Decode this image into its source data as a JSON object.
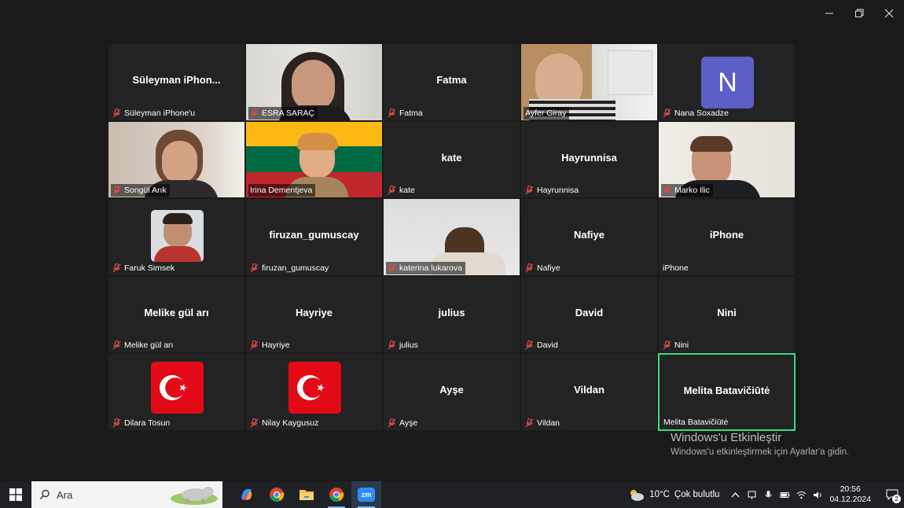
{
  "window": {
    "controls": [
      "minimize-icon",
      "restore-icon",
      "close-icon"
    ]
  },
  "tiles": [
    {
      "center": "Süleyman  iPhon...",
      "caption": "Süleyman iPhone'u",
      "muted": true,
      "kind": "name"
    },
    {
      "center": "",
      "caption": "ESRA SARAÇ",
      "muted": true,
      "kind": "video"
    },
    {
      "center": "Fatma",
      "caption": "Fatma",
      "muted": true,
      "kind": "name"
    },
    {
      "center": "",
      "caption": "Ayfer Giray",
      "muted": false,
      "kind": "video"
    },
    {
      "center": "",
      "caption": "Nana Soxadze",
      "muted": true,
      "kind": "avatar",
      "initial": "N"
    },
    {
      "center": "",
      "caption": "Songül Arık",
      "muted": true,
      "kind": "video"
    },
    {
      "center": "",
      "caption": "Irina Dementjeva",
      "muted": false,
      "kind": "video"
    },
    {
      "center": "kate",
      "caption": "kate",
      "muted": true,
      "kind": "name"
    },
    {
      "center": "Hayrunnisa",
      "caption": "Hayrunnisa",
      "muted": true,
      "kind": "name"
    },
    {
      "center": "",
      "caption": "Marko Ilic",
      "muted": true,
      "kind": "video"
    },
    {
      "center": "",
      "caption": "Faruk Simsek",
      "muted": true,
      "kind": "photo"
    },
    {
      "center": "firuzan_gumuscay",
      "caption": "firuzan_gumuscay",
      "muted": true,
      "kind": "name"
    },
    {
      "center": "",
      "caption": "katerina lukarova",
      "muted": true,
      "kind": "video"
    },
    {
      "center": "Nafiye",
      "caption": "Nafiye",
      "muted": true,
      "kind": "name"
    },
    {
      "center": "iPhone",
      "caption": "iPhone",
      "muted": false,
      "kind": "name"
    },
    {
      "center": "Melike gül arı",
      "caption": "Melike gül arı",
      "muted": true,
      "kind": "name"
    },
    {
      "center": "Hayriye",
      "caption": "Hayriye",
      "muted": true,
      "kind": "name"
    },
    {
      "center": "julius",
      "caption": "julius",
      "muted": true,
      "kind": "name"
    },
    {
      "center": "David",
      "caption": "David",
      "muted": true,
      "kind": "name"
    },
    {
      "center": "Nini",
      "caption": "Nini",
      "muted": true,
      "kind": "name"
    },
    {
      "center": "",
      "caption": "Dilara Tosun",
      "muted": true,
      "kind": "flag"
    },
    {
      "center": "",
      "caption": "Nilay Kaygusuz",
      "muted": true,
      "kind": "flag"
    },
    {
      "center": "Ayşe",
      "caption": "Ayşe",
      "muted": true,
      "kind": "name"
    },
    {
      "center": "Vildan",
      "caption": "Vildan",
      "muted": true,
      "kind": "name"
    },
    {
      "center": "Melita Batavičiūtė",
      "caption": "Melita Batavičiūtė",
      "muted": false,
      "kind": "name",
      "active": true
    }
  ],
  "watermark": {
    "title": "Windows'u Etkinleştir",
    "subtitle": "Windows'u etkinleştirmek için Ayarlar'a gidin."
  },
  "taskbar": {
    "search_placeholder": "Ara",
    "apps": [
      "copilot-icon",
      "chrome-icon",
      "file-explorer-icon",
      "chrome-profile-icon",
      "zoom-icon"
    ],
    "zoom_label": "zm",
    "weather_temp": "10°C",
    "weather_text": "Çok bulutlu",
    "time": "20:56",
    "date": "04.12.2024",
    "notification_count": "2"
  },
  "colors": {
    "active_speaker": "#3ddc84",
    "mute": "#e04a4a",
    "avatar_bg": "#5b5fc7",
    "flag_red": "#e30a17"
  }
}
